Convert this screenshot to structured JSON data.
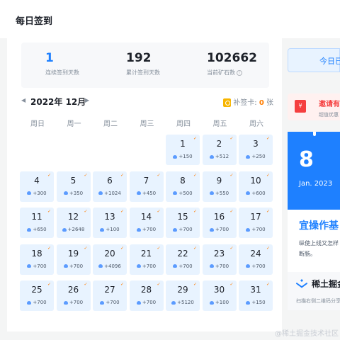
{
  "header": {
    "title": "每日签到"
  },
  "stats": [
    {
      "value": "1",
      "label": "连续签到天数"
    },
    {
      "value": "192",
      "label": "累计签到天数"
    },
    {
      "value": "102662",
      "label": "当前矿石数"
    }
  ],
  "calendar": {
    "month_label": "2022年 12月",
    "prev_icon": "caret-left-icon",
    "next_icon": "caret-right-icon",
    "makeup_label": "补签卡:",
    "makeup_count": "0",
    "makeup_unit": "张",
    "weekdays": [
      "周日",
      "周一",
      "周二",
      "周三",
      "周四",
      "周五",
      "周六"
    ],
    "days": [
      {
        "day": "1",
        "points": "+150"
      },
      {
        "day": "2",
        "points": "+512"
      },
      {
        "day": "3",
        "points": "+250"
      },
      {
        "day": "4",
        "points": "+300"
      },
      {
        "day": "5",
        "points": "+350"
      },
      {
        "day": "6",
        "points": "+1024"
      },
      {
        "day": "7",
        "points": "+450"
      },
      {
        "day": "8",
        "points": "+500"
      },
      {
        "day": "9",
        "points": "+550"
      },
      {
        "day": "10",
        "points": "+600"
      },
      {
        "day": "11",
        "points": "+650"
      },
      {
        "day": "12",
        "points": "+2648"
      },
      {
        "day": "13",
        "points": "+100"
      },
      {
        "day": "14",
        "points": "+700"
      },
      {
        "day": "15",
        "points": "+700"
      },
      {
        "day": "16",
        "points": "+700"
      },
      {
        "day": "17",
        "points": "+700"
      },
      {
        "day": "18",
        "points": "+700"
      },
      {
        "day": "19",
        "points": "+700"
      },
      {
        "day": "20",
        "points": "+4096"
      },
      {
        "day": "21",
        "points": "+700"
      },
      {
        "day": "22",
        "points": "+700"
      },
      {
        "day": "23",
        "points": "+700"
      },
      {
        "day": "24",
        "points": "+700"
      },
      {
        "day": "25",
        "points": "+700"
      },
      {
        "day": "26",
        "points": "+700"
      },
      {
        "day": "27",
        "points": "+700"
      },
      {
        "day": "28",
        "points": "+700"
      },
      {
        "day": "29",
        "points": "+5120"
      },
      {
        "day": "30",
        "points": "+100"
      },
      {
        "day": "31",
        "points": "+150"
      }
    ],
    "first_weekday_index": 4
  },
  "sidebar": {
    "button_label": "今日已",
    "promo_title": "邀请有",
    "promo_sub": "超值优惠",
    "red_icon": "red-envelope-icon",
    "cal_day": "8",
    "cal_month": "Jan. 2023",
    "cal_title": "宜操作基",
    "cal_desc_1": "纵使上线又怎样",
    "cal_desc_2": "断肠。",
    "brand": "稀土掘金",
    "scan_text": "扫描右侧二维码分享"
  },
  "watermark": "@稀土掘金技术社区",
  "colors": {
    "accent": "#1e80ff",
    "check": "#ff7d00",
    "day_bg": "#e8f3ff"
  }
}
